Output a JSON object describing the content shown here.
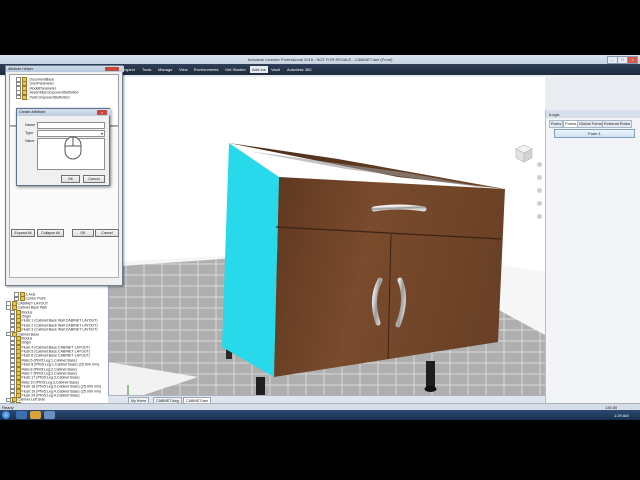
{
  "window": {
    "title": "Autodesk Inventor Professional 2015 - NOT FOR RESALE - CABINET.iam (Front)",
    "minimize": "–",
    "maximize": "□",
    "close": "×"
  },
  "ribbon": {
    "tabs": [
      "Inspect",
      "Tools",
      "Manage",
      "View",
      "Environments",
      "Get Started",
      "Add-Ins",
      "Vault",
      "Autodesk 360"
    ],
    "active_tab": "Add-Ins"
  },
  "attribute_helper": {
    "title": "Attribute Helper",
    "tree_items": [
      "_DocumentBase",
      "_UserParameter",
      "_ModelParameter",
      "_AssemblyComponentDefinition",
      "_PartComponentDefinition"
    ],
    "expand_all": "Expand All",
    "collapse_all": "Collapse All",
    "ok": "OK",
    "cancel": "Cancel"
  },
  "create_attribute": {
    "title": "Create Attribute",
    "name_label": "Name",
    "type_label": "Type",
    "value_label": "Value",
    "ok": "OK",
    "cancel": "Cancel"
  },
  "browser": {
    "rows": [
      {
        "text": "Z Axis",
        "indent": 3
      },
      {
        "text": "Center Point",
        "indent": 3
      },
      {
        "text": "CABINET LAYOUT",
        "indent": 1
      },
      {
        "text": "Cabinet Back Wall",
        "indent": 1
      },
      {
        "text": "Modus",
        "indent": 2
      },
      {
        "text": "Origin",
        "indent": 2
      },
      {
        "text": "Flush:1 (Cabinet:Back Wall:CABINET LAYOUT)",
        "indent": 2
      },
      {
        "text": "Flush:2 (Cabinet:Back Wall:CABINET LAYOUT)",
        "indent": 2
      },
      {
        "text": "Flush:3 (Cabinet:Back Wall:CABINET LAYOUT)",
        "indent": 2
      },
      {
        "text": "Cabinet Base",
        "indent": 1
      },
      {
        "text": "Modus",
        "indent": 2
      },
      {
        "text": "Origin",
        "indent": 2
      },
      {
        "text": "Flush:4 (Cabinet:Base:CABINET LAYOUT)",
        "indent": 2
      },
      {
        "text": "Flush:5 (Cabinet:Base:CABINET LAYOUT)",
        "indent": 2
      },
      {
        "text": "Flush:6 (Cabinet:Base:CABINET LAYOUT)",
        "indent": 2
      },
      {
        "text": "Mate:6 (Pfm5:Leg:1,Cabinet Base)",
        "indent": 2
      },
      {
        "text": "Flush:8 (Pfm5:Leg:1,Cabinet Base) (25.000 mm)",
        "indent": 2
      },
      {
        "text": "Mate:8 (Pfm5:Leg:2,Cabinet Base)",
        "indent": 2
      },
      {
        "text": "Mate:7 (Pfm5:Leg:2,Cabinet Base)",
        "indent": 2
      },
      {
        "text": "Flush:17 (Pfm5:Leg:3,Cabinet Base)",
        "indent": 2
      },
      {
        "text": "Mate:10 (Pfm5:Leg:3,Cabinet Base)",
        "indent": 2
      },
      {
        "text": "Flush:18 (Pfm5:Leg:3,Cabinet Base) (25.000 mm)",
        "indent": 2
      },
      {
        "text": "Flush:19 (Pfm5:Leg:4,Cabinet Base) (25.000 mm)",
        "indent": 2
      },
      {
        "text": "Flush:24 (Pfm5:Leg:4,Cabinet Base)",
        "indent": 2
      },
      {
        "text": "Cabinet Left Side",
        "indent": 1
      },
      {
        "text": "Modus",
        "indent": 2
      }
    ]
  },
  "right_panel": {
    "title": "iLogic",
    "tabs": [
      "Rules",
      "Forms",
      "Global Forms",
      "External Rules"
    ],
    "active_tab": "Forms",
    "form_button": "Form 1"
  },
  "document_tabs": [
    "My Home",
    "CABINET.dwg",
    "CABINET.iam"
  ],
  "active_document_tab": "CABINET.iam",
  "status": {
    "left": "Ready",
    "right": "135  80"
  },
  "taskbar": {
    "clock": "1:29 AM"
  },
  "colors": {
    "cabinet_wood": "#6e4328",
    "cabinet_side": "#27d9ea",
    "ribbon_bg": "#2a3a51",
    "floor_tile": "#a6a6a6"
  }
}
